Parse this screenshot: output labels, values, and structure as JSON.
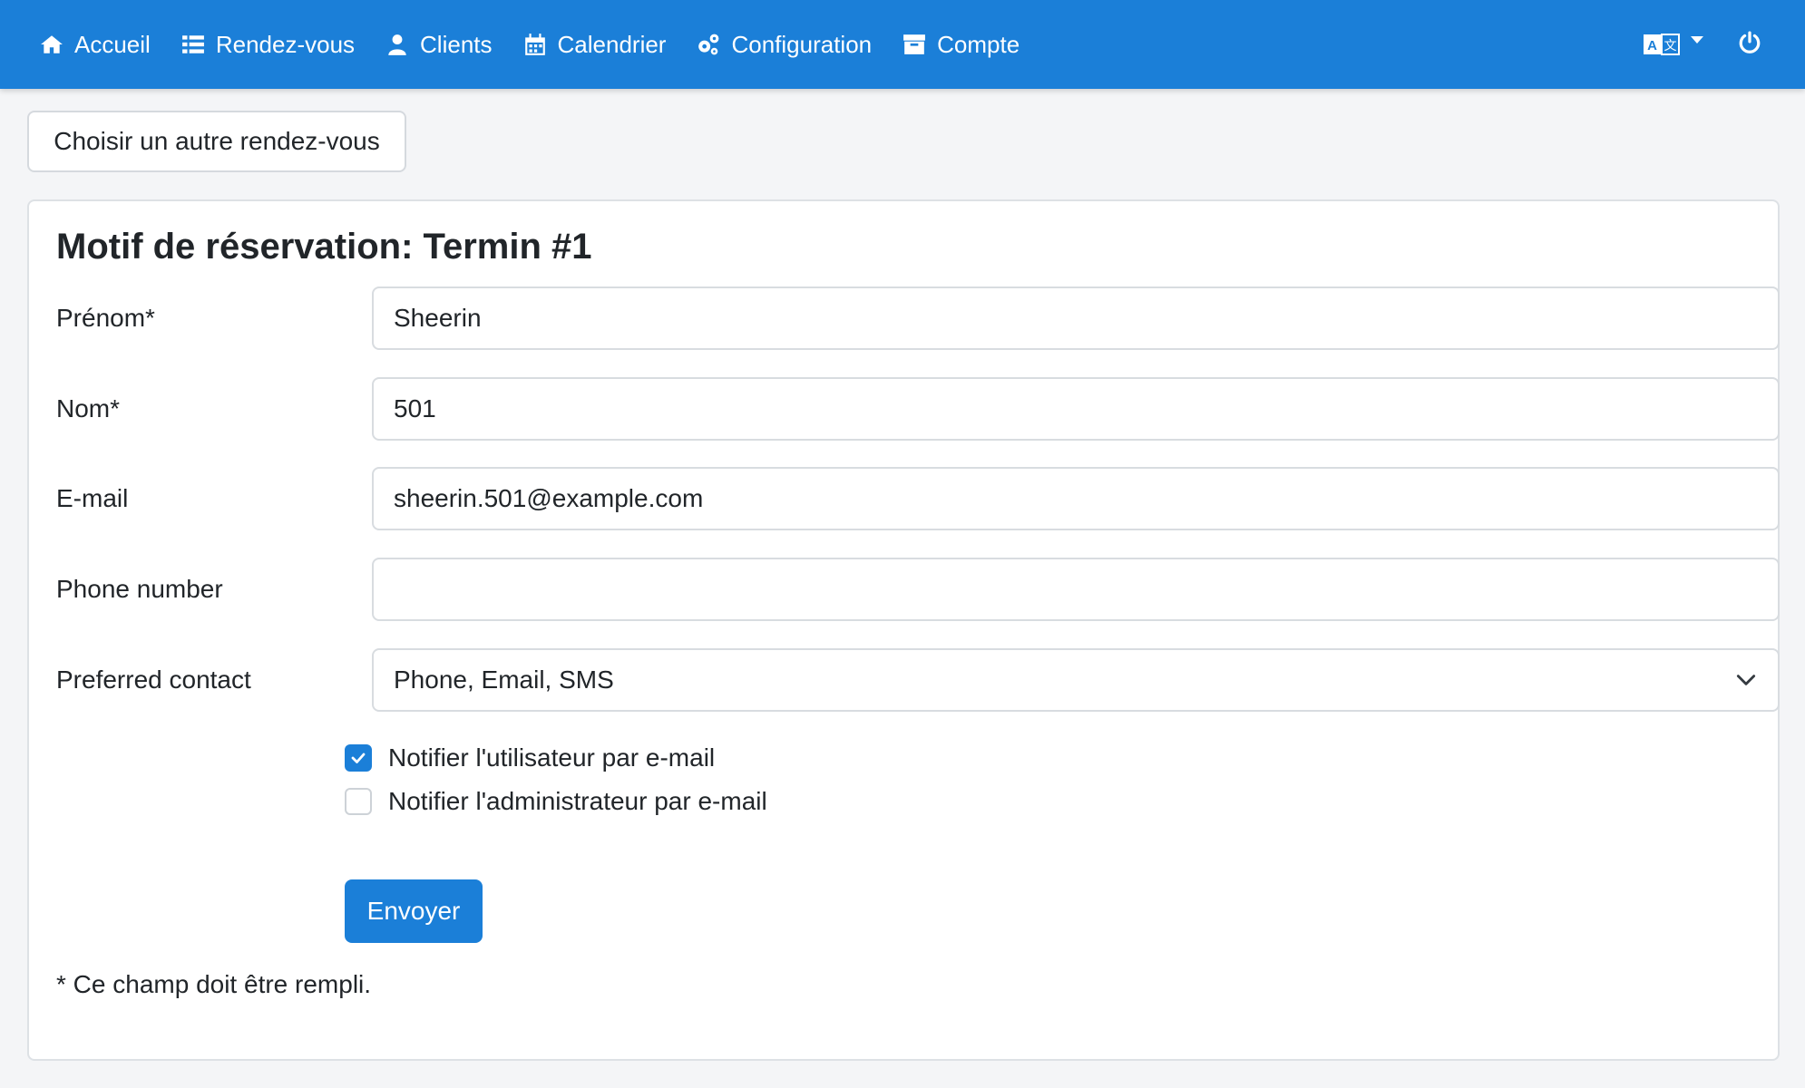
{
  "navbar": {
    "items": [
      {
        "label": "Accueil",
        "icon": "home-icon"
      },
      {
        "label": "Rendez-vous",
        "icon": "list-icon"
      },
      {
        "label": "Clients",
        "icon": "user-icon"
      },
      {
        "label": "Calendrier",
        "icon": "calendar-icon"
      },
      {
        "label": "Configuration",
        "icon": "gears-icon"
      },
      {
        "label": "Compte",
        "icon": "archive-icon"
      }
    ],
    "language_icon": "language-icon",
    "logout_icon": "power-icon",
    "color": "#1b7fd8"
  },
  "back_button": {
    "label": "Choisir un autre rendez-vous"
  },
  "form": {
    "title": "Motif de réservation: Termin #1",
    "fields": {
      "first_name": {
        "label": "Prénom*",
        "value": "Sheerin"
      },
      "last_name": {
        "label": "Nom*",
        "value": "501"
      },
      "email": {
        "label": "E-mail",
        "value": "sheerin.501@example.com"
      },
      "phone": {
        "label": "Phone number",
        "value": ""
      },
      "preferred_contact": {
        "label": "Preferred contact",
        "value": "Phone, Email, SMS"
      }
    },
    "checkboxes": {
      "notify_user": {
        "label": "Notifier l'utilisateur par e-mail",
        "checked": true
      },
      "notify_admin": {
        "label": "Notifier l'administrateur par e-mail",
        "checked": false
      }
    },
    "submit_label": "Envoyer",
    "required_note": "* Ce champ doit être rempli."
  }
}
